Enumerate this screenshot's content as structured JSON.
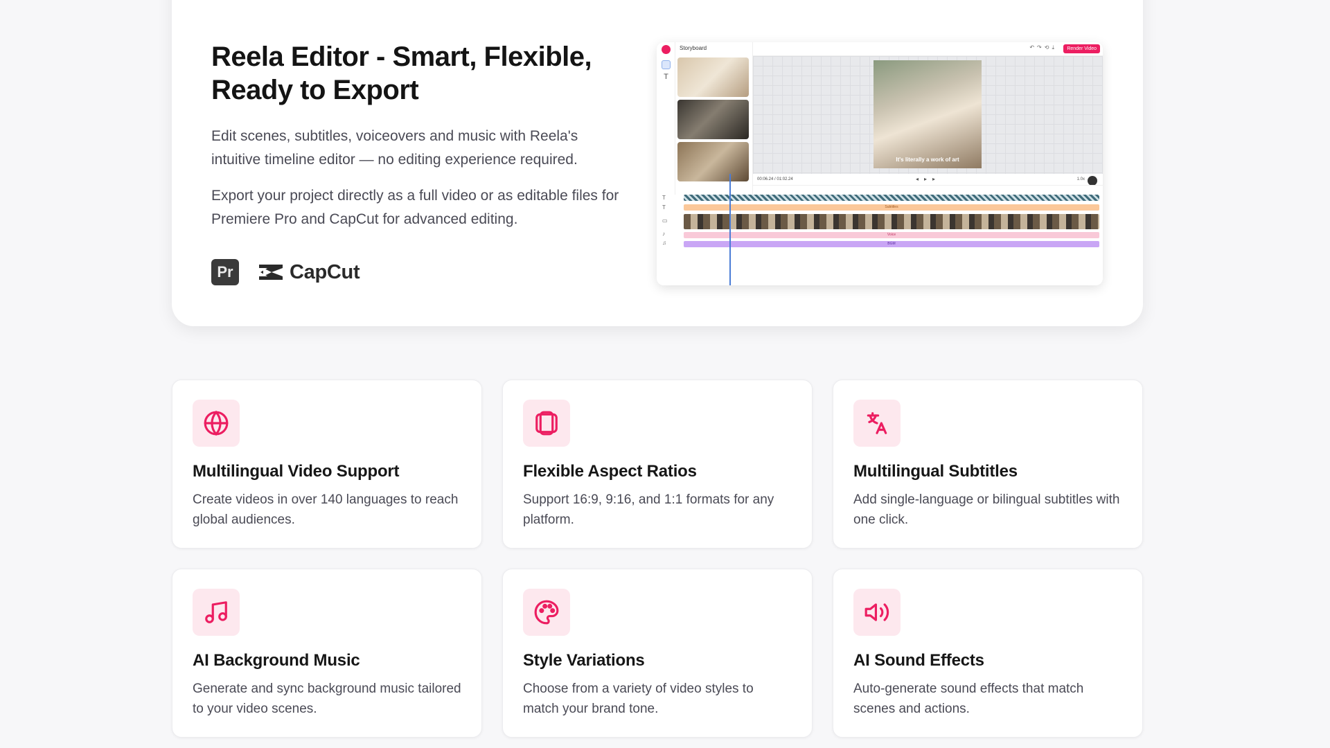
{
  "hero": {
    "title": "Reela Editor - Smart, Flexible, Ready to Export",
    "paragraph1": "Edit scenes, subtitles, voiceovers and music with Reela's intuitive timeline editor — no editing experience required.",
    "paragraph2": "Export your project directly as a full video or as editable files for Premiere Pro and CapCut for advanced editing.",
    "logos": {
      "premiere": "Pr",
      "capcut": "CapCut"
    }
  },
  "editor": {
    "storyboard_label": "Storyboard",
    "render_button": "Render Video",
    "caption": "It's literally a work of art",
    "time": "00:06.24 / 01:02.24",
    "zoom": "1.0x",
    "tracks": {
      "subtitles": "Subtitles",
      "voice": "Voice",
      "bgm": "BGM"
    }
  },
  "features": [
    {
      "icon": "globe-icon",
      "title": "Multilingual Video Support",
      "desc": "Create videos in over 140 languages to reach global audiences."
    },
    {
      "icon": "aspect-ratio-icon",
      "title": "Flexible Aspect Ratios",
      "desc": "Support 16:9, 9:16, and 1:1 formats for any platform."
    },
    {
      "icon": "translate-icon",
      "title": "Multilingual Subtitles",
      "desc": "Add single-language or bilingual subtitles with one click."
    },
    {
      "icon": "music-note-icon",
      "title": "AI Background Music",
      "desc": "Generate and sync background music tailored to your video scenes."
    },
    {
      "icon": "palette-icon",
      "title": "Style Variations",
      "desc": "Choose from a variety of video styles to match your brand tone."
    },
    {
      "icon": "speaker-icon",
      "title": "AI Sound Effects",
      "desc": "Auto-generate sound effects that match scenes and actions."
    }
  ],
  "colors": {
    "accent": "#ec1e61",
    "icon_bg": "#fde8ee"
  }
}
